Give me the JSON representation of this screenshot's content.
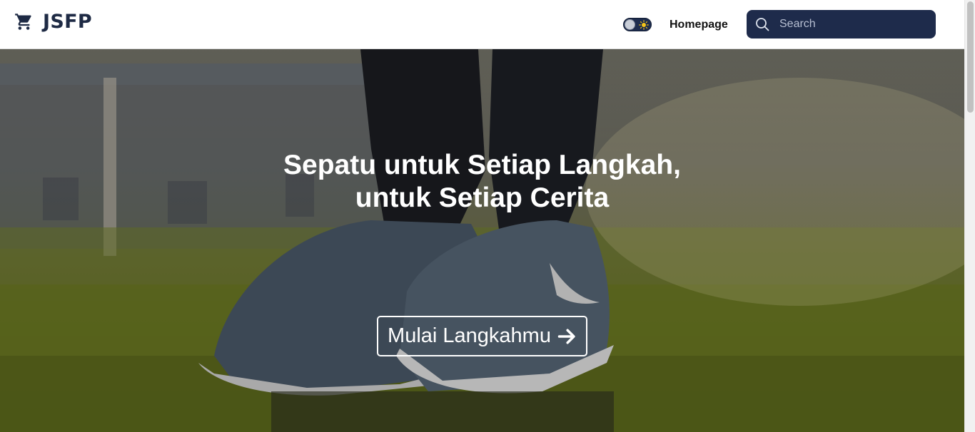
{
  "navbar": {
    "brand": {
      "icon": "cart-icon",
      "name": "JSFP"
    },
    "theme_toggle": {
      "icon": "sun-icon",
      "state": "light"
    },
    "links": [
      {
        "label": "Homepage"
      }
    ],
    "search": {
      "placeholder": "Search",
      "value": "",
      "icon": "search-icon"
    }
  },
  "hero": {
    "title_line1": "Sepatu untuk Setiap Langkah,",
    "title_line2": "untuk Setiap Cerita",
    "cta": {
      "label": "Mulai Langkahmu",
      "icon": "arrow-right-icon"
    }
  },
  "colors": {
    "brand_text": "#1e2a44",
    "search_bg": "#1e2b4b",
    "toggle_bg": "#1e2d4f",
    "hero_text": "#ffffff"
  }
}
